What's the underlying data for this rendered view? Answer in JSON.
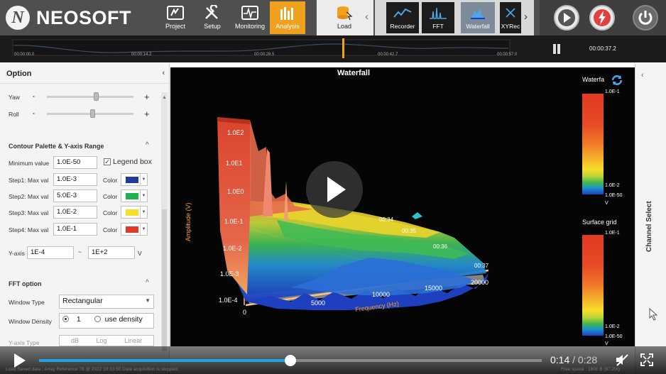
{
  "app": {
    "logo_mark": "N",
    "logo_text": "NEOSOFT"
  },
  "nav": {
    "items": [
      {
        "label": "Project"
      },
      {
        "label": "Setup"
      },
      {
        "label": "Monitoring"
      },
      {
        "label": "Analysis",
        "active": true
      }
    ]
  },
  "load": {
    "label": "Load"
  },
  "tools": [
    {
      "label": "Recorder"
    },
    {
      "label": "FFT"
    },
    {
      "label": "Waterfall",
      "active": true
    },
    {
      "label": "XYRec"
    }
  ],
  "timeline": {
    "ticks": [
      "00:00:00.0",
      "00:00:14.2",
      "00:00:28.5",
      "00:00:42.7",
      "00:00:57.0"
    ],
    "current_time": "00:00:37.2"
  },
  "option_panel": {
    "title": "Option",
    "yaw_label": "Yaw",
    "roll_label": "Roll",
    "minus": "-",
    "plus": "+",
    "contour_title": "Contour Palette & Y-axis Range",
    "min_label": "Minimum value",
    "min_value": "1.0E-50",
    "legend_box_label": "Legend box",
    "color_label": "Color",
    "steps": [
      {
        "label": "Step1: Max val",
        "value": "1.0E-3",
        "color": "#1f3a9c"
      },
      {
        "label": "Step2: Max val",
        "value": "5.0E-3",
        "color": "#1db34a"
      },
      {
        "label": "Step3: Max val",
        "value": "1.0E-2",
        "color": "#f6df2c"
      },
      {
        "label": "Step4: Max val",
        "value": "1.0E-1",
        "color": "#e03a25"
      }
    ],
    "yaxis_label": "Y-axis",
    "yaxis_min": "1E-4",
    "yaxis_sep": "~",
    "yaxis_max": "1E+2",
    "yaxis_unit": "V",
    "fft_title": "FFT option",
    "window_type_label": "Window Type",
    "window_type_value": "Rectangular",
    "window_density_label": "Window Density",
    "window_density_value": "1",
    "use_density_label": "use density",
    "yaxis_type_label": "Y-axis Type",
    "yaxis_type_options": [
      "dB",
      "Log",
      "Linear"
    ]
  },
  "plot": {
    "title": "Waterfall",
    "ylabel": "Amplitude (V)",
    "xlabel": "Frequency (Hz)",
    "y_ticks": [
      "1.0E2",
      "1.0E1",
      "1.0E0",
      "1.0E-1",
      "1.0E-2",
      "1.0E-3",
      "1.0E-4"
    ],
    "x_ticks": [
      "0",
      "5000",
      "10000",
      "15000",
      "20000"
    ],
    "time_ticks": [
      "00:34",
      "00:35",
      "00:36",
      "00:37"
    ],
    "legend1_title": "Waterfa",
    "legend1_top": "1.0E-1",
    "legend1_mid": "1.0E-2",
    "legend1_bottom": "1.0E-50",
    "legend1_unit": "V",
    "legend2_title": "Surface grid",
    "legend2_top": "1.0E-1",
    "legend2_mid": "1.0E-2",
    "legend2_bottom": "1.0E-50",
    "legend2_unit": "V"
  },
  "channel_panel": {
    "label": "Channel Select"
  },
  "video": {
    "current": "0:14",
    "separator": " / ",
    "total": "0:28",
    "progress": 0.5
  },
  "status": {
    "left": "Load Saved data : Array Reference 78 @ 2022 10:33:50    Data acquisition is stopped.",
    "right": "Free space : 1800 B (97.2%)"
  }
}
